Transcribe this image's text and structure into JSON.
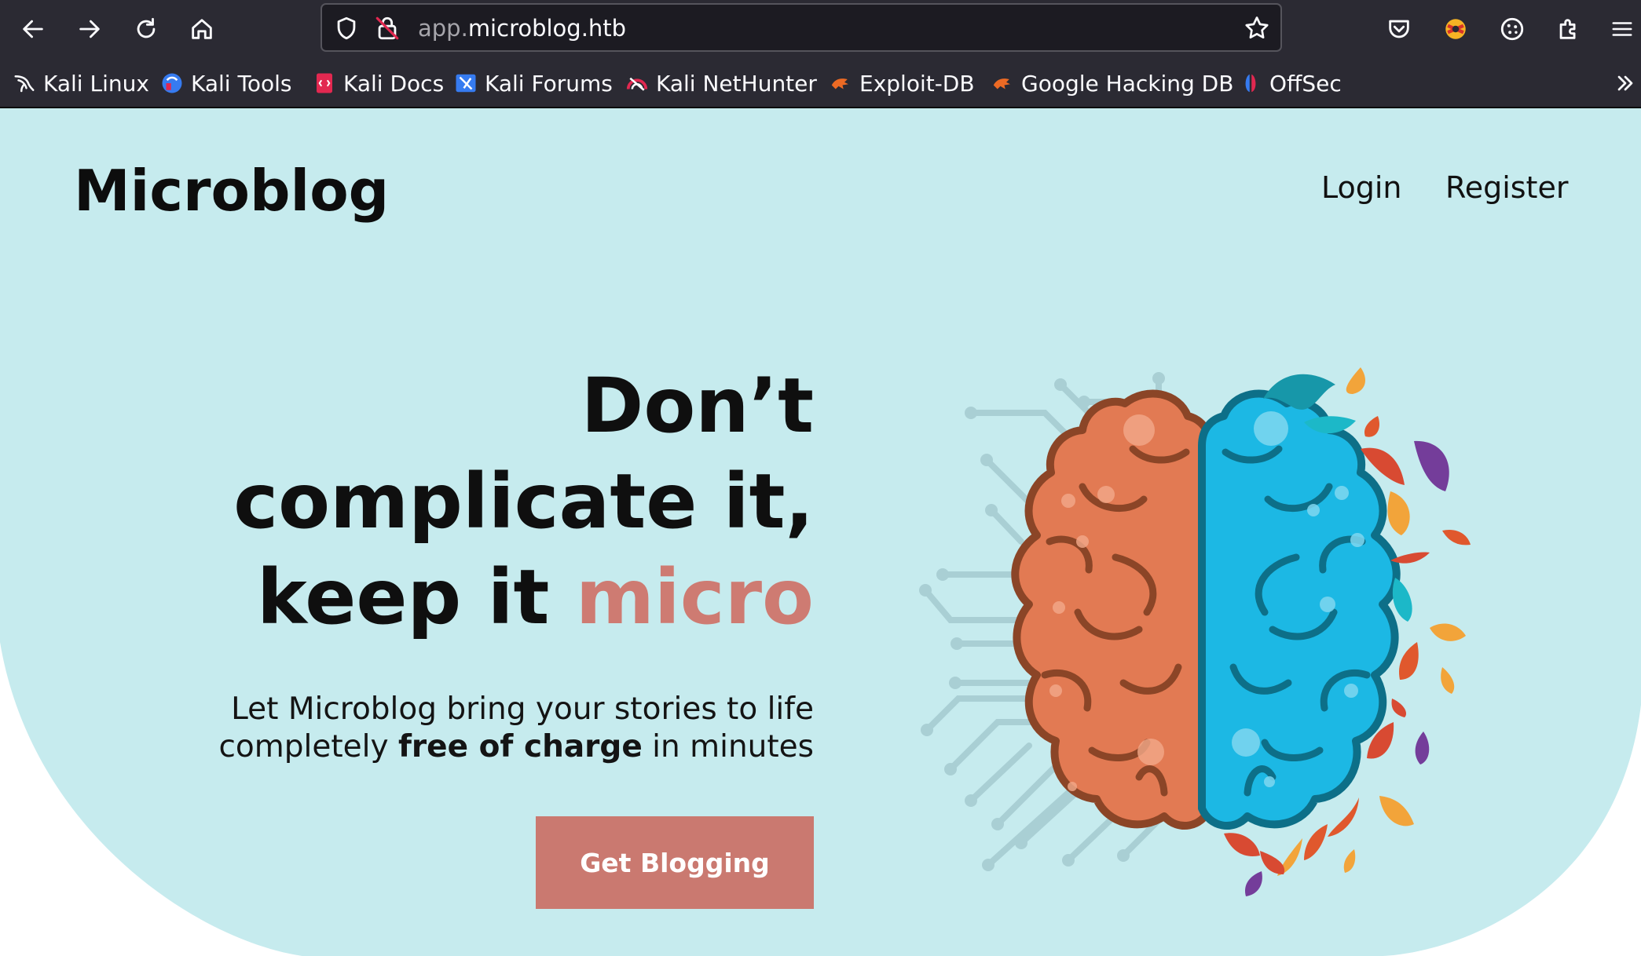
{
  "browser": {
    "url": {
      "subdomain": "app.",
      "domain": "microblog.htb"
    },
    "nav_icons": [
      "back-arrow-icon",
      "forward-arrow-icon",
      "reload-icon",
      "home-icon"
    ],
    "toolbar_icons": [
      "pocket-icon",
      "profile-extension-icon",
      "cookie-icon",
      "extensions-puzzle-icon",
      "hamburger-menu-icon"
    ],
    "bookmarks": [
      {
        "label": "Kali Linux",
        "icon": "kali-dragon-icon"
      },
      {
        "label": "Kali Tools",
        "icon": "kali-tools-icon"
      },
      {
        "label": "Kali Docs",
        "icon": "kali-docs-icon"
      },
      {
        "label": "Kali Forums",
        "icon": "kali-forums-icon"
      },
      {
        "label": "Kali NetHunter",
        "icon": "nethunter-icon"
      },
      {
        "label": "Exploit-DB",
        "icon": "exploit-db-icon"
      },
      {
        "label": "Google Hacking DB",
        "icon": "ghdb-icon"
      },
      {
        "label": "OffSec",
        "icon": "offsec-icon"
      }
    ]
  },
  "site": {
    "logo": "Microblog",
    "nav": {
      "login": "Login",
      "register": "Register"
    },
    "hero": {
      "headline_line1": "Don’t",
      "headline_line2": "complicate it,",
      "headline_line3_prefix": "keep it ",
      "headline_accent": "micro",
      "sub_line1": "Let Microblog bring your stories to life",
      "sub_line2_prefix": "completely ",
      "sub_line2_bold": "free of charge",
      "sub_line2_suffix": " in minutes",
      "cta": "Get Blogging",
      "illustration": "brain-illustration"
    }
  },
  "colors": {
    "toolbar_bg": "#2b2a33",
    "hero_bg": "#c6ebee",
    "accent": "#ce7b72",
    "button_bg": "#ca7970",
    "brain_left": "#e27a53",
    "brain_right": "#1cb8e4"
  }
}
